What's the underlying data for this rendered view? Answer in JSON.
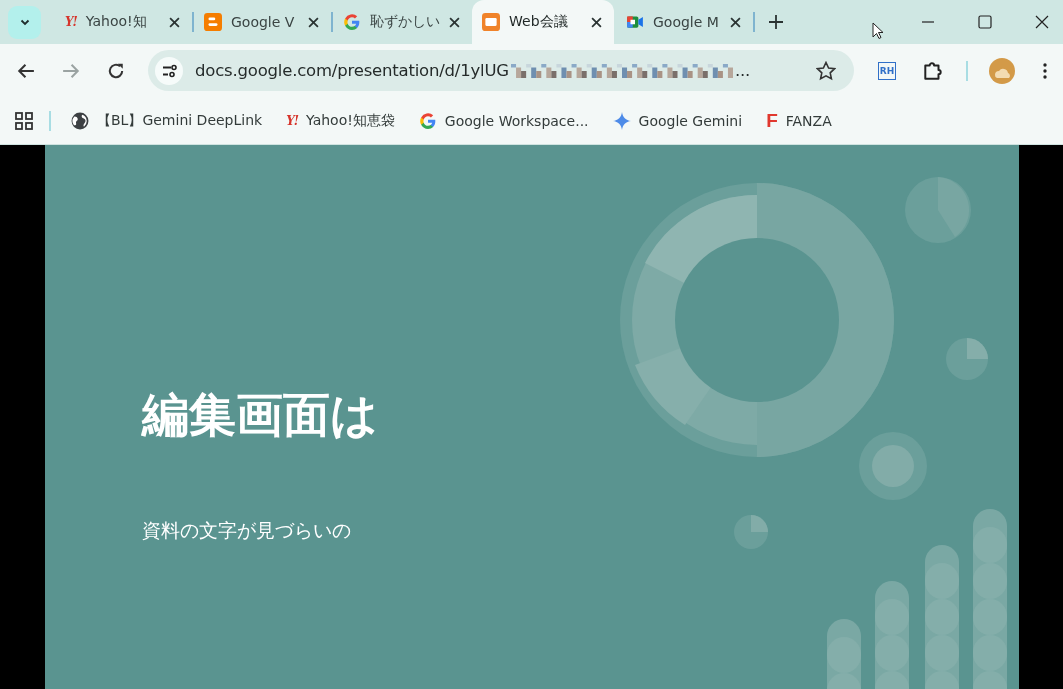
{
  "tabs": [
    {
      "kind": "yahoo",
      "logo": "Y!",
      "title": "Yahoo!知",
      "selected": false
    },
    {
      "kind": "blogger",
      "title": "Google V",
      "selected": false
    },
    {
      "kind": "google",
      "title": "恥ずかしい",
      "selected": false
    },
    {
      "kind": "slides",
      "title": "Web会議",
      "selected": true
    },
    {
      "kind": "meet",
      "title": "Google M",
      "selected": false
    }
  ],
  "address": {
    "url": "docs.google.com/presentation/d/1ylUG",
    "ellipsis": "..."
  },
  "bookmarks": [
    {
      "kind": "globe",
      "label": "【BL】Gemini DeepLink"
    },
    {
      "kind": "yahoo",
      "logo": "Y!",
      "label": "Yahoo!知恵袋"
    },
    {
      "kind": "google",
      "label": "Google Workspace..."
    },
    {
      "kind": "gemini",
      "label": "Google Gemini"
    },
    {
      "kind": "fanza",
      "logo": "F",
      "label": "FANZA"
    }
  ],
  "extension": {
    "logo": "RH"
  },
  "slide": {
    "title": "編集画面は",
    "subtitle": "資料の文字が見づらいの"
  }
}
